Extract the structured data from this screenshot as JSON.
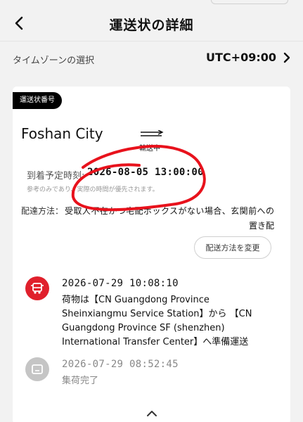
{
  "header": {
    "title": "運送状の詳細"
  },
  "timezone": {
    "label": "タイムゾーンの選択",
    "value": "UTC+09:00"
  },
  "shipment": {
    "tag": "運送状番号",
    "origin": "Foshan City",
    "status": "輸送中",
    "eta_label": "到着予定時刻:",
    "eta_value": "2026-08-05 13:00:00",
    "eta_note": "参考のみであり、実際の時間が優先されます。",
    "method_label": "配達方法：",
    "method_value": "受取人不在かつ宅配ボックスがない場合、玄関前への置き配",
    "change_button": "配送方法を変更"
  },
  "events": [
    {
      "time": "2026-07-29 10:08:10",
      "description": "荷物は【CN Guangdong Province Sheinxiangmu Service Station】から 【CN Guangdong Province SF (shenzhen) International Transfer Center】へ準備運送",
      "icon": "truck-icon",
      "color": "#e0202c"
    },
    {
      "time": "2026-07-29 08:52:45",
      "description": "集荷完了",
      "icon": "package-icon",
      "color": "#c5c5c5"
    }
  ],
  "colors": {
    "accent": "#e0202c",
    "annotation": "#e8121c"
  }
}
